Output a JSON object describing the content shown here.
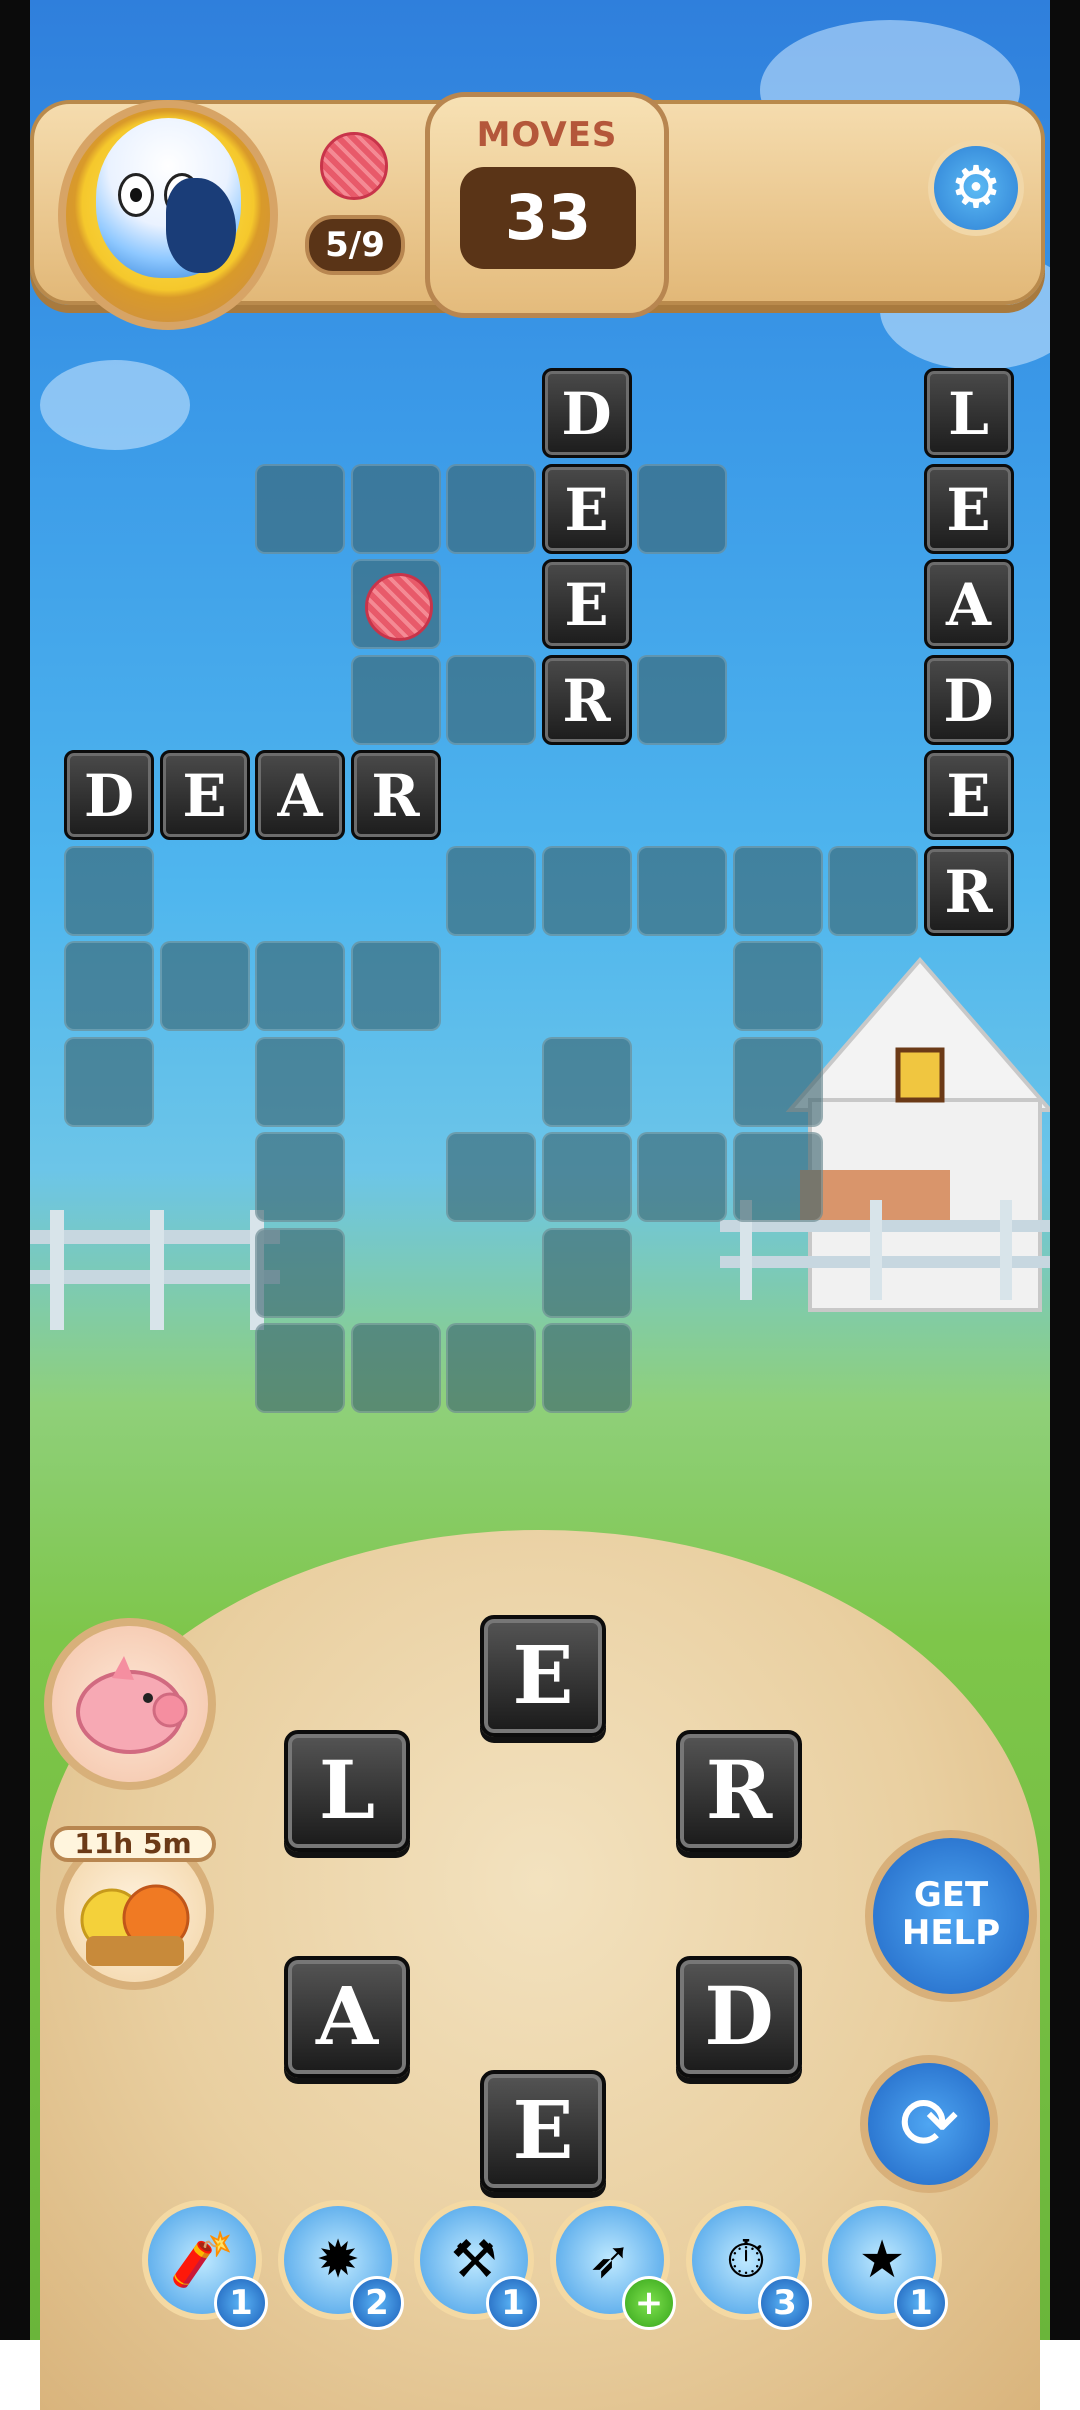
{
  "header": {
    "yarn_progress": "5/9",
    "moves_label": "MOVES",
    "moves_value": "33"
  },
  "board": {
    "words": {
      "across_1": [
        "D",
        "E",
        "A",
        "R"
      ],
      "down_1": [
        "D",
        "E",
        "E",
        "R"
      ],
      "down_2": [
        "L",
        "E",
        "A",
        "D",
        "E",
        "R"
      ]
    }
  },
  "wheel": {
    "letters": [
      "E",
      "L",
      "R",
      "A",
      "D",
      "E"
    ]
  },
  "sidebar": {
    "timer": "11h 5m",
    "get_help_label": "GET HELP"
  },
  "boosters": [
    {
      "icon": "firecracker-icon",
      "count": "1"
    },
    {
      "icon": "dynamite-icon",
      "count": "2"
    },
    {
      "icon": "hammer-icon",
      "count": "1"
    },
    {
      "icon": "rocket-icon",
      "count": "+"
    },
    {
      "icon": "stopwatch-icon",
      "count": "3"
    },
    {
      "icon": "magic-wand-icon",
      "count": "1"
    }
  ],
  "colors": {
    "yarn": "#e85a6a",
    "accent_blue": "#2d7fd4",
    "wood": "#e2b878"
  }
}
